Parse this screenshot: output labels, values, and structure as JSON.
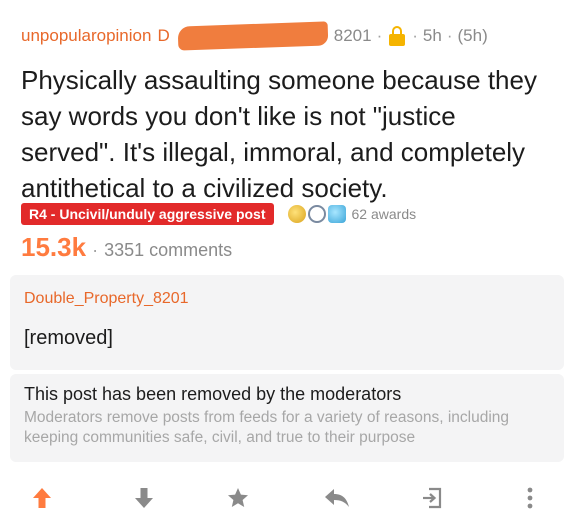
{
  "post": {
    "subreddit": "unpopularopinion",
    "author_visible_fragment": "D",
    "author_tail_fragment": "8201",
    "age": "5h",
    "age_detail": "(5h)",
    "title": "Physically assaulting someone because they say words you don't like is not \"justice served\". It's illegal, immoral, and completely antithetical to a civilized society.",
    "flair": "R4 - Uncivil/unduly aggressive post",
    "awards_label": "62 awards",
    "score": "15.3k",
    "comments_label": "3351 comments"
  },
  "comment": {
    "author": "Double_Property_8201",
    "body": "[removed]"
  },
  "removal_notice": {
    "title": "This post has been removed by the moderators",
    "description": "Moderators remove posts from feeds for a variety of reasons, including keeping communities safe, civil, and true to their purpose"
  },
  "actions": [
    "upvote-icon",
    "downvote-icon",
    "save-star-icon",
    "reply-icon",
    "share-icon",
    "more-icon"
  ],
  "colors": {
    "accent": "#ff7b3f",
    "flair_bg": "#e22a2a",
    "lock": "#f5b400",
    "redaction": "#f07d3e"
  }
}
